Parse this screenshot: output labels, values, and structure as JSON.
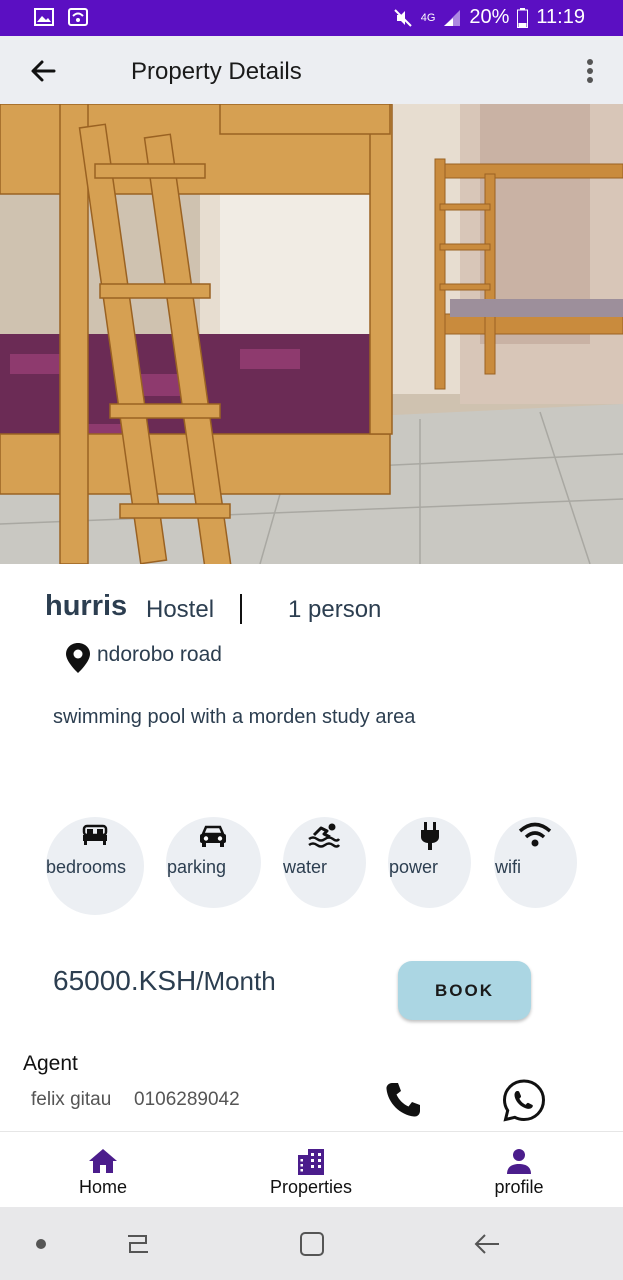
{
  "status_bar": {
    "network": "4G",
    "battery": "20%",
    "time": "11:19",
    "icons": [
      "image-icon",
      "wifi-icon",
      "mute-icon",
      "signal-icon",
      "battery-icon"
    ]
  },
  "app_bar": {
    "title": "Property Details",
    "back_icon": "arrow-left-icon",
    "menu_icon": "more-vertical-icon"
  },
  "gallery": {
    "image_count": 5,
    "active_index": 1
  },
  "property": {
    "name": "hurris",
    "type": "Hostel",
    "capacity": "1 person",
    "location": "ndorobo road",
    "description": "swimming pool with a morden study area"
  },
  "amenities": [
    {
      "label": "bedrooms",
      "icon": "bed-icon"
    },
    {
      "label": "parking",
      "icon": "car-icon"
    },
    {
      "label": "water",
      "icon": "swimming-icon"
    },
    {
      "label": "power",
      "icon": "plug-icon"
    },
    {
      "label": "wifi",
      "icon": "wifi-icon"
    }
  ],
  "pricing": {
    "amount": "65000.KSH",
    "period": "/Month"
  },
  "book_button": {
    "label": "BOOK"
  },
  "agent": {
    "heading": "Agent",
    "name": "felix gitau",
    "phone": "0106289042"
  },
  "bottom_nav": [
    {
      "label": "Home",
      "icon": "home-icon"
    },
    {
      "label": "Properties",
      "icon": "building-icon"
    },
    {
      "label": "profile",
      "icon": "person-icon"
    }
  ],
  "colors": {
    "status_bar": "#5b0fc2",
    "nav_icon": "#4b1d8c",
    "book_button": "#abd6e3",
    "amenity_bg": "#eceff3",
    "text": "#2c3e50"
  }
}
